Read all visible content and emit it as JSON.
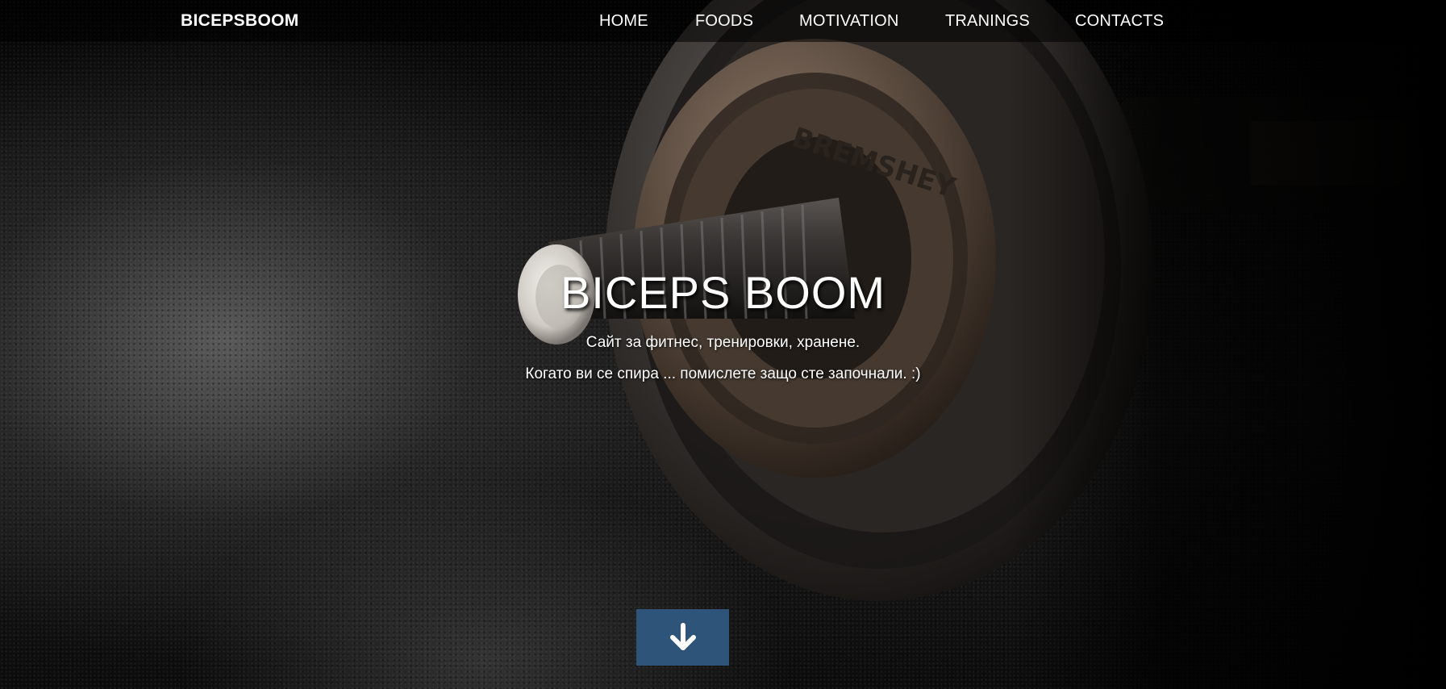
{
  "navbar": {
    "brand": "BICEPSBOOM",
    "links": [
      {
        "label": "HOME"
      },
      {
        "label": "FOODS"
      },
      {
        "label": "MOTIVATION"
      },
      {
        "label": "TRANINGS"
      },
      {
        "label": "CONTACTS"
      }
    ]
  },
  "hero": {
    "title": "BICEPS BOOM",
    "subtitle": "Сайт за фитнес, тренировки, хранене.",
    "tagline": "Когато ви се спира ... помислете защо сте започнали. :)",
    "plate_text": "BREMSHEY"
  },
  "scroll_button": {
    "icon": "arrow-down-icon"
  },
  "colors": {
    "accent": "#2f5479",
    "nav_bg": "#000000",
    "text": "#ffffff"
  }
}
